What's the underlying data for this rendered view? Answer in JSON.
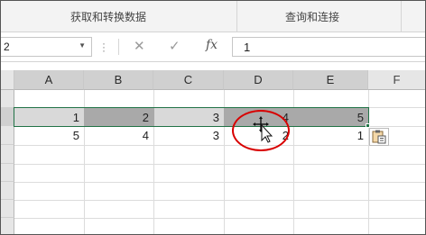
{
  "ribbon": {
    "group1": "获取和转换数据",
    "group2": "查询和连接"
  },
  "formula_bar": {
    "name_box": "2",
    "cancel_icon": "✕",
    "enter_icon": "✓",
    "fx_label": "fx",
    "content": "1"
  },
  "sheet": {
    "columns": [
      "A",
      "B",
      "C",
      "D",
      "E",
      "F"
    ],
    "selected_columns": [
      "A",
      "B",
      "C",
      "D",
      "E"
    ],
    "rows": [
      {
        "values": [
          "1",
          "2",
          "3",
          "4",
          "5"
        ],
        "selected": true
      },
      {
        "values": [
          "5",
          "4",
          "3",
          "2",
          "1"
        ],
        "selected": false
      }
    ]
  },
  "annotation": {
    "color": "#d80000",
    "shape": "red-ellipse-around-cursor"
  },
  "colors": {
    "selection_border": "#217346",
    "header_selected": "#d0d0d0",
    "selected_dark": "#a9a9a9"
  },
  "icons": [
    "cancel-icon",
    "enter-icon",
    "fx-icon",
    "name-box-dropdown-icon",
    "paste-options-icon",
    "move-cursor-icon"
  ]
}
